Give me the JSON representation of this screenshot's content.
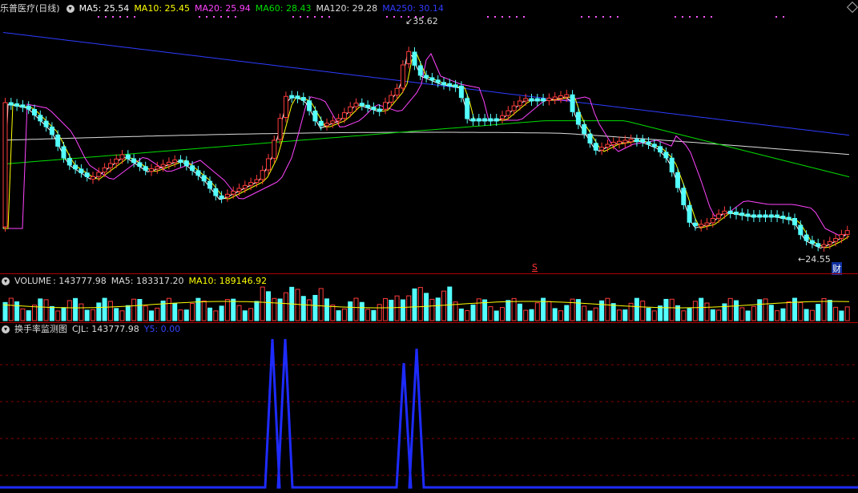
{
  "main": {
    "stock_name": "乐普医疗",
    "period": "(日线)",
    "indicators": [
      {
        "label": "MA5: 25.54",
        "color": "#ffffff"
      },
      {
        "label": "MA10: 25.45",
        "color": "#ffff00"
      },
      {
        "label": "MA20: 25.94",
        "color": "#ff44ff"
      },
      {
        "label": "MA60: 28.43",
        "color": "#00dd00"
      },
      {
        "label": "MA120: 29.28",
        "color": "#dddddd"
      },
      {
        "label": "MA250: 30.14",
        "color": "#2f3cff"
      }
    ],
    "high_label": "35.62",
    "low_label": "24.55",
    "marker_s": "S",
    "marker_cai": "财"
  },
  "volume": {
    "name": "VOLUME",
    "value": "143777.98",
    "ma5": "MA5: 183317.20",
    "ma10": "MA10: 189146.92",
    "colors": {
      "name": "#dddddd",
      "ma5": "#dddddd",
      "ma10": "#ffff00"
    }
  },
  "turnover": {
    "title": "换手率监测图",
    "cjl": "CJL: 143777.98",
    "y5": "Y5: 0.00",
    "colors": {
      "title": "#dddddd",
      "cjl": "#dddddd",
      "y5": "#3344ff"
    }
  },
  "colors": {
    "up": "#ff3b3b",
    "down": "#54ffff",
    "grid": "#8a0000",
    "signal": "#1e2bff"
  }
}
